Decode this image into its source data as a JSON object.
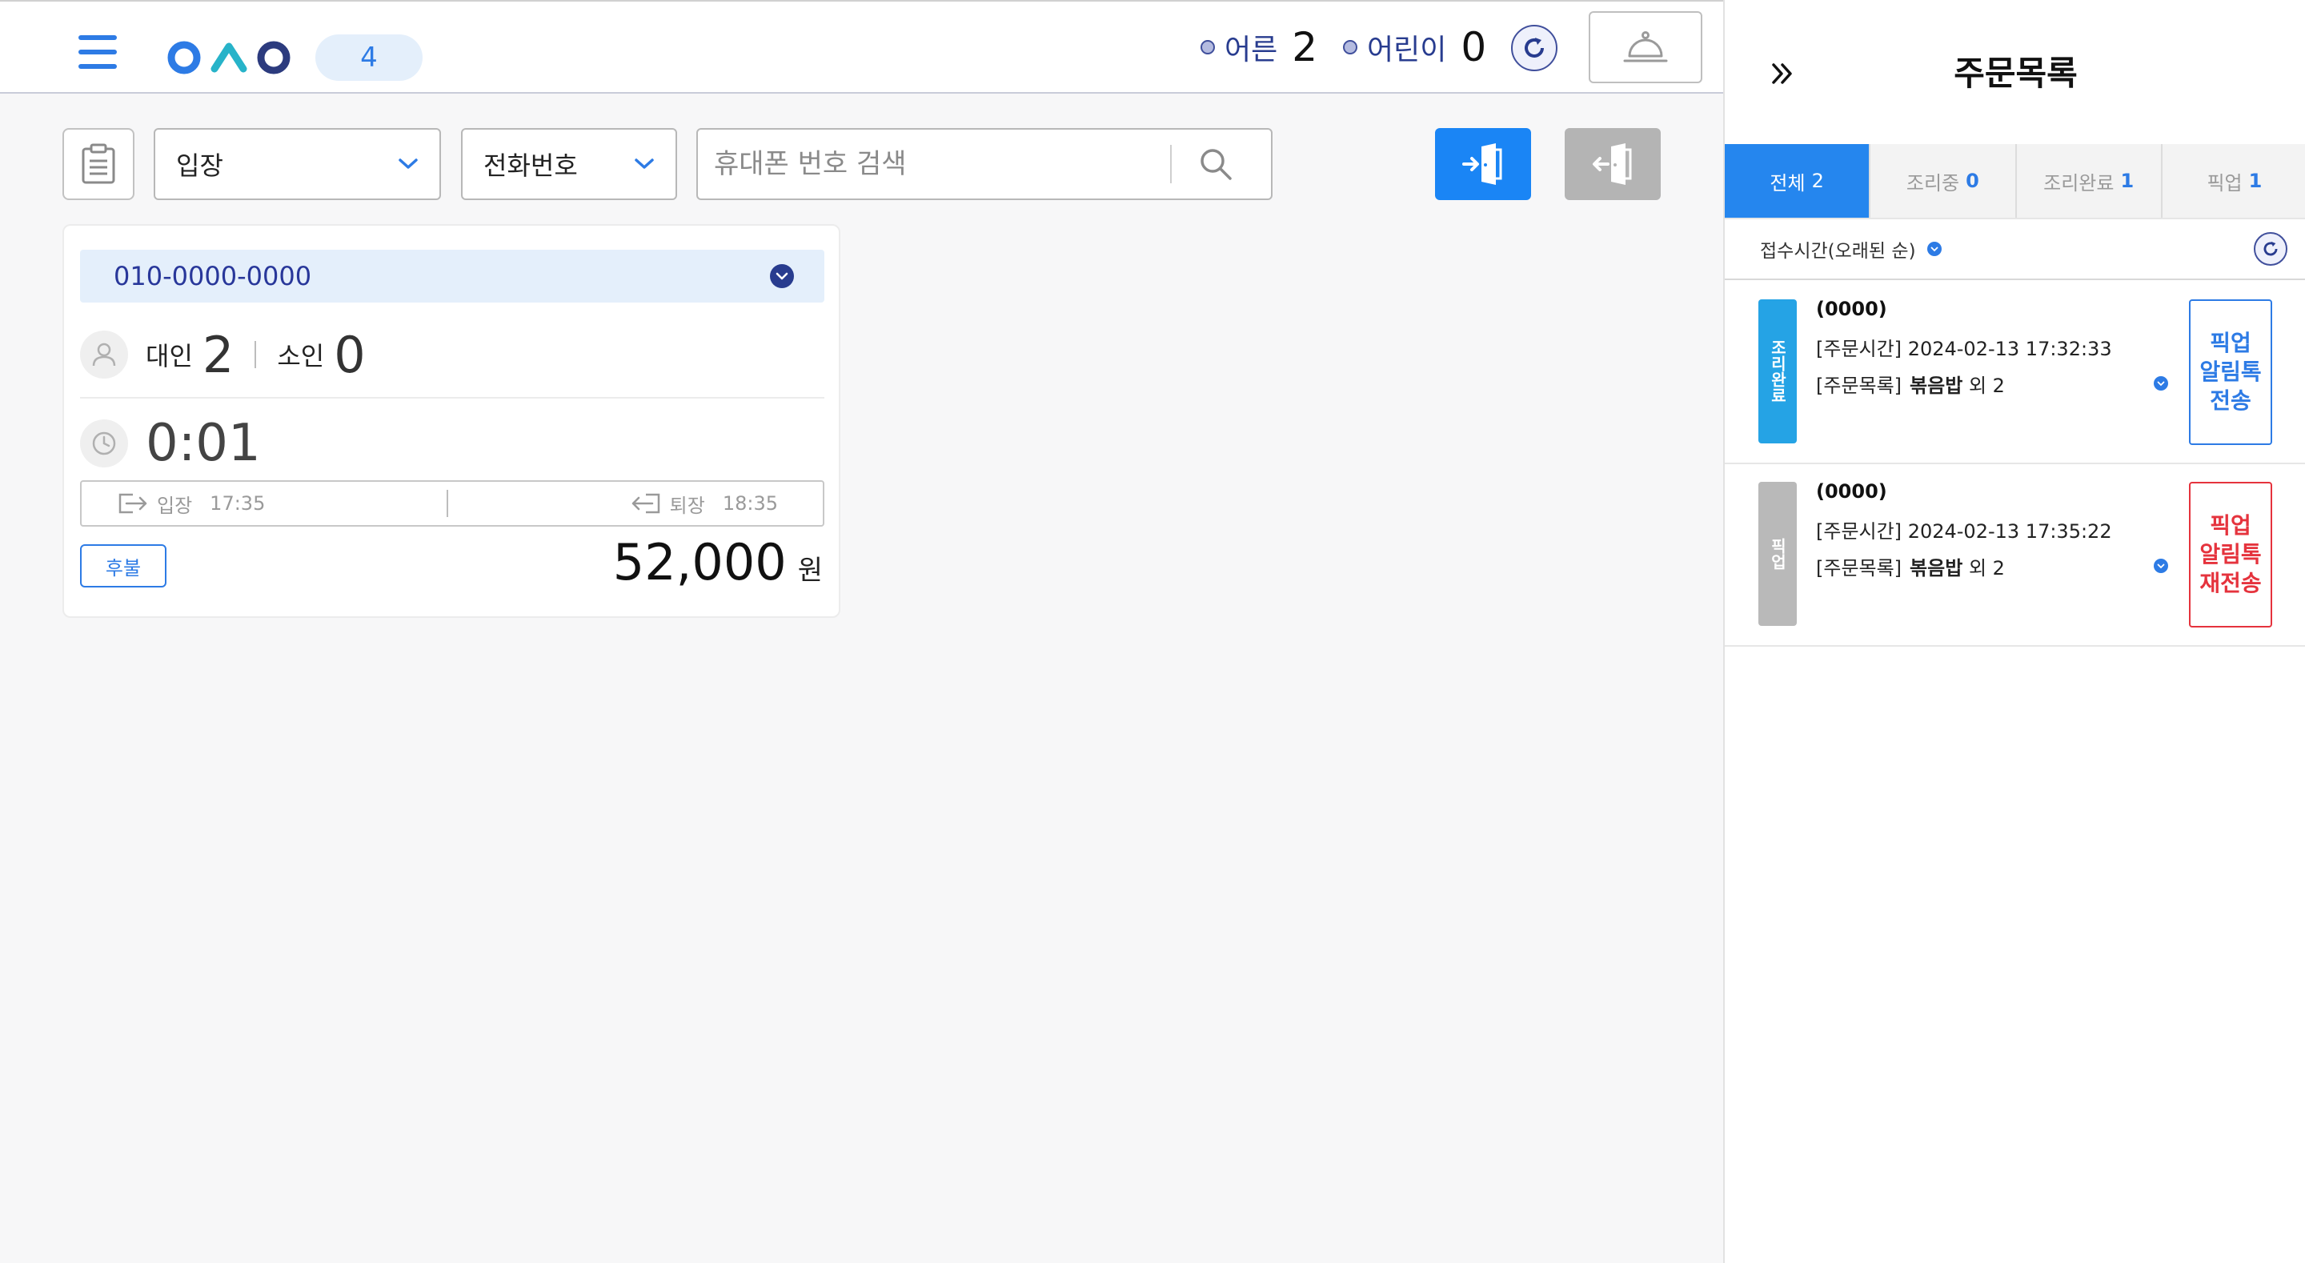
{
  "header": {
    "menu_icon": "hamburger-icon",
    "logo_icon": "oao-logo",
    "count_badge": "4",
    "adult_label": "어른",
    "adult_count": "2",
    "child_label": "어린이",
    "child_count": "0",
    "refresh_icon": "refresh-icon",
    "bell_icon": "service-bell-icon"
  },
  "toolbar": {
    "calendar_icon": "calendar-icon",
    "status_select": "입장",
    "type_select": "전화번호",
    "search_placeholder": "휴대폰 번호 검색",
    "search_icon": "search-icon",
    "enter_icon": "door-enter-icon",
    "exit_icon": "door-exit-icon"
  },
  "card": {
    "phone": "010-0000-0000",
    "adult_label": "대인",
    "adult_count": "2",
    "child_label": "소인",
    "child_count": "0",
    "elapsed": "0:01",
    "entry_label": "입장",
    "entry_time": "17:35",
    "exit_label": "퇴장",
    "exit_time": "18:35",
    "payment_badge": "후불",
    "price": "52,000",
    "currency": "원"
  },
  "panel": {
    "title": "주문목록",
    "collapse_icon": "double-chevron-right-icon",
    "tabs": [
      {
        "label": "전체",
        "count": "2",
        "active": true
      },
      {
        "label": "조리중",
        "count": "0",
        "active": false
      },
      {
        "label": "조리완료",
        "count": "1",
        "active": false
      },
      {
        "label": "픽업",
        "count": "1",
        "active": false
      }
    ],
    "sort_label": "접수시간(오래된 순)",
    "orders": [
      {
        "status": "조리완료",
        "status_color": "#25a3e5",
        "id": "(0000)",
        "time_label": "[주문시간]",
        "time": "2024-02-13 17:32:33",
        "menu_label": "[주문목록]",
        "menu_item": "볶음밥",
        "menu_more": "외 2",
        "action": "픽업 알림톡 전송",
        "action_color": "#2d7be5"
      },
      {
        "status": "픽업",
        "status_color": "#b9b9b9",
        "id": "(0000)",
        "time_label": "[주문시간]",
        "time": "2024-02-13 17:35:22",
        "menu_label": "[주문목록]",
        "menu_item": "볶음밥",
        "menu_more": "외 2",
        "action": "픽업 알림톡 재전송",
        "action_color": "#e5333d"
      }
    ]
  },
  "colors": {
    "accent": "#2d7be5",
    "navy": "#283c8f",
    "enter_button": "#1a85f5",
    "exit_button": "#b4b4b4"
  }
}
